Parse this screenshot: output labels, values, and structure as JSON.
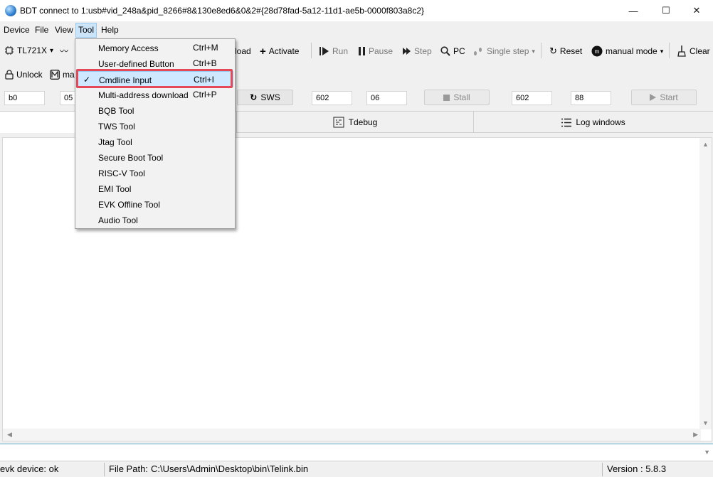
{
  "window": {
    "title": "BDT connect to 1:usb#vid_248a&pid_8266#8&130e8ed6&0&2#{28d78fad-5a12-11d1-ae5b-0000f803a8c2}",
    "minimize_glyph": "—",
    "maximize_glyph": "☐",
    "close_glyph": "✕"
  },
  "menubar": {
    "items": [
      "Device",
      "File",
      "View",
      "Tool",
      "Help"
    ]
  },
  "toolbar1": {
    "chip": "TL721X",
    "chip_arrow": "▾",
    "wave_glyph": "〰",
    "download_label": "load",
    "activate": "Activate",
    "run": "Run",
    "pause": "Pause",
    "step": "Step",
    "pc": "PC",
    "single_step": "Single step",
    "reset": "Reset",
    "manual_mode": "manual mode",
    "clear": "Clear"
  },
  "toolbar2": {
    "unlock": "Unlock",
    "ma_label": "ma"
  },
  "toolbar3": {
    "field1": "b0",
    "field2": "05",
    "sws": "SWS",
    "field3": "602",
    "field4": "06",
    "stall": "Stall",
    "field5": "602",
    "field6": "88",
    "start": "Start"
  },
  "tabs": {
    "tdebug": "Tdebug",
    "log_windows": "Log windows"
  },
  "tool_menu": {
    "items": [
      {
        "label": "Memory Access",
        "shortcut": "Ctrl+M",
        "checked": false
      },
      {
        "label": "User-defined Button",
        "shortcut": "Ctrl+B",
        "checked": false
      },
      {
        "label": "Cmdline Input",
        "shortcut": "Ctrl+I",
        "checked": true
      },
      {
        "label": "Multi-address download",
        "shortcut": "Ctrl+P",
        "checked": false
      },
      {
        "label": "BQB Tool",
        "shortcut": "",
        "checked": false
      },
      {
        "label": "TWS Tool",
        "shortcut": "",
        "checked": false
      },
      {
        "label": "Jtag Tool",
        "shortcut": "",
        "checked": false
      },
      {
        "label": "Secure Boot Tool",
        "shortcut": "",
        "checked": false
      },
      {
        "label": "RISC-V Tool",
        "shortcut": "",
        "checked": false
      },
      {
        "label": "EMI Tool",
        "shortcut": "",
        "checked": false
      },
      {
        "label": "EVK Offline Tool",
        "shortcut": "",
        "checked": false
      },
      {
        "label": "Audio Tool",
        "shortcut": "",
        "checked": false
      }
    ],
    "check_glyph": "✓"
  },
  "statusbar": {
    "device": "evk device: ok",
    "file_path_label": "File Path:",
    "file_path": "C:\\Users\\Admin\\Desktop\\bin\\Telink.bin",
    "version": "Version : 5.8.3"
  },
  "colors": {
    "highlight_border": "#e54856",
    "selected_bg": "#cde8ff"
  }
}
